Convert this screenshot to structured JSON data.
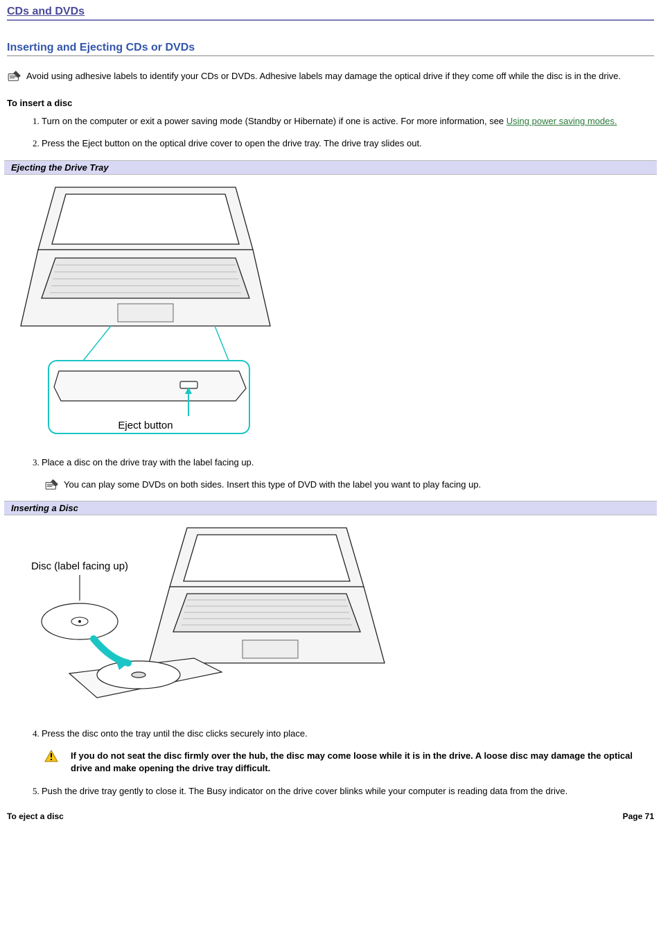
{
  "page_title": "CDs and DVDs",
  "section_heading": "Inserting and Ejecting CDs or DVDs",
  "top_note": "Avoid using adhesive labels to identify your CDs or DVDs. Adhesive labels may damage the optical drive if they come off while the disc is in the drive.",
  "insert_heading": "To insert a disc",
  "steps": {
    "s1_a": "Turn on the computer or exit a power saving mode (Standby or Hibernate) if one is active. For more information, see ",
    "s1_link": "Using power saving modes.",
    "s2": "Press the Eject button on the optical drive cover to open the drive tray. The drive tray slides out.",
    "s3": "Place a disc on the drive tray with the label facing up.",
    "s3_note": "You can play some DVDs on both sides. Insert this type of DVD with the label you want to play facing up.",
    "s4": "Press the disc onto the tray until the disc clicks securely into place.",
    "s4_warn": "If you do not seat the disc firmly over the hub, the disc may come loose while it is in the drive. A loose disc may damage the optical drive and make opening the drive tray difficult.",
    "s5": "Push the drive tray gently to close it. The Busy indicator on the drive cover blinks while your computer is reading data from the drive."
  },
  "caption1": "Ejecting the Drive Tray",
  "caption2": "Inserting a Disc",
  "illus1_label": "Eject button",
  "illus2_label": "Disc (label facing up)",
  "eject_heading": "To eject a disc",
  "page_number": "Page 71"
}
